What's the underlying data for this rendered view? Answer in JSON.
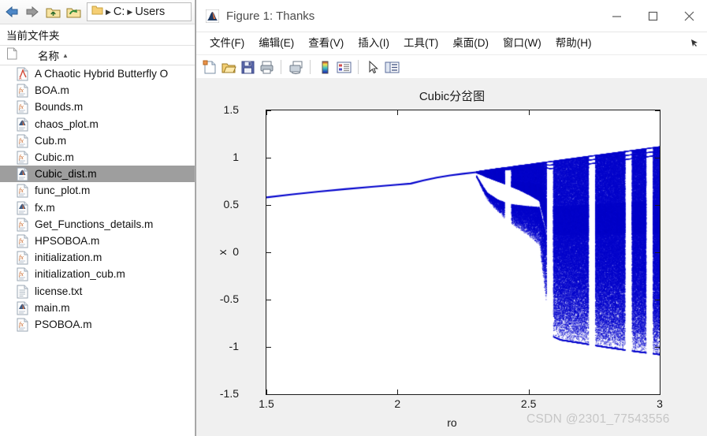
{
  "explorer": {
    "nav": {
      "back_icon": "back-arrow-icon",
      "forward_icon": "forward-arrow-icon",
      "up_icon": "up-folder-icon",
      "refresh_icon": "refresh-folder-icon"
    },
    "path": {
      "root_icon": "folder-icon",
      "crumbs": [
        "C:",
        "Users"
      ]
    },
    "panel_title": "当前文件夹",
    "column_header": {
      "label": "名称",
      "sort": "▲"
    },
    "files": [
      {
        "name": "A Chaotic Hybrid Butterfly O",
        "icon": "pdf-file-icon",
        "selected": false
      },
      {
        "name": "BOA.m",
        "icon": "m-function-icon",
        "selected": false
      },
      {
        "name": "Bounds.m",
        "icon": "m-function-icon",
        "selected": false
      },
      {
        "name": "chaos_plot.m",
        "icon": "m-script-icon",
        "selected": false
      },
      {
        "name": "Cub.m",
        "icon": "m-function-icon",
        "selected": false
      },
      {
        "name": "Cubic.m",
        "icon": "m-function-icon",
        "selected": false
      },
      {
        "name": "Cubic_dist.m",
        "icon": "m-script-icon",
        "selected": true
      },
      {
        "name": "func_plot.m",
        "icon": "m-function-icon",
        "selected": false
      },
      {
        "name": "fx.m",
        "icon": "m-script-icon",
        "selected": false
      },
      {
        "name": "Get_Functions_details.m",
        "icon": "m-function-icon",
        "selected": false
      },
      {
        "name": "HPSOBOA.m",
        "icon": "m-function-icon",
        "selected": false
      },
      {
        "name": "initialization.m",
        "icon": "m-function-icon",
        "selected": false
      },
      {
        "name": "initialization_cub.m",
        "icon": "m-function-icon",
        "selected": false
      },
      {
        "name": "license.txt",
        "icon": "text-file-icon",
        "selected": false
      },
      {
        "name": "main.m",
        "icon": "m-script-icon",
        "selected": false
      },
      {
        "name": "PSOBOA.m",
        "icon": "m-function-icon",
        "selected": false
      }
    ]
  },
  "figure": {
    "title": "Figure 1: Thanks",
    "app_icon": "matlab-figure-icon",
    "window_controls": {
      "minimize": "–",
      "maximize": "□",
      "close": "✕"
    },
    "menus": [
      {
        "label": "文件(F)"
      },
      {
        "label": "编辑(E)"
      },
      {
        "label": "查看(V)"
      },
      {
        "label": "插入(I)"
      },
      {
        "label": "工具(T)"
      },
      {
        "label": "桌面(D)"
      },
      {
        "label": "窗口(W)"
      },
      {
        "label": "帮助(H)"
      }
    ],
    "menu_overflow_icon": "overflow-arrow-icon",
    "toolbar": [
      {
        "name": "new-figure-icon"
      },
      {
        "name": "open-file-icon"
      },
      {
        "name": "save-figure-icon"
      },
      {
        "name": "print-figure-icon"
      },
      {
        "sep": true
      },
      {
        "name": "link-plot-icon"
      },
      {
        "sep": true
      },
      {
        "name": "colorbar-icon"
      },
      {
        "name": "legend-icon"
      },
      {
        "sep": true
      },
      {
        "name": "pointer-select-icon"
      },
      {
        "name": "plot-browser-icon"
      }
    ],
    "watermark": "CSDN @2301_77543556"
  },
  "chart_data": {
    "type": "scatter",
    "title": "Cubic分岔图",
    "xlabel": "ro",
    "ylabel": "x",
    "xlim": [
      1.5,
      3
    ],
    "ylim": [
      -1.5,
      1.5
    ],
    "xticks": [
      1.5,
      2,
      2.5,
      3
    ],
    "xticklabels": [
      "1.5",
      "2",
      "2.5",
      "3"
    ],
    "yticks": [
      -1.5,
      -1,
      -0.5,
      0,
      0.5,
      1,
      1.5
    ],
    "yticklabels": [
      "-1.5",
      "-1",
      "-0.5",
      "0",
      "0.5",
      "1",
      "1.5"
    ],
    "grid": false,
    "legend": null,
    "color": "#0000cc",
    "marker": "dot",
    "description": "Bifurcation diagram of the cubic map x -> ro*x*(1-x^2); single stable branch for ro in [1.5, ~2.3] rising from x=0.58 to x=0.85, then period doubling and a broad chaotic band widening to x in [-1.08, 1.12] at ro=3, with several periodic windows appearing as vertical white gaps.",
    "branch_curve": [
      {
        "ro": 1.5,
        "x": 0.58
      },
      {
        "ro": 1.6,
        "x": 0.612
      },
      {
        "ro": 1.7,
        "x": 0.642
      },
      {
        "ro": 1.8,
        "x": 0.668
      },
      {
        "ro": 1.9,
        "x": 0.692
      },
      {
        "ro": 2.0,
        "x": 0.714
      },
      {
        "ro": 2.05,
        "x": 0.726
      },
      {
        "ro": 2.1,
        "x": 0.76
      },
      {
        "ro": 2.15,
        "x": 0.79
      },
      {
        "ro": 2.2,
        "x": 0.812
      },
      {
        "ro": 2.25,
        "x": 0.83
      },
      {
        "ro": 2.3,
        "x": 0.846
      }
    ],
    "bifurcation_start_ro": 2.3,
    "chaos_band": [
      {
        "ro": 2.3,
        "upper": 0.855,
        "lower": 0.8
      },
      {
        "ro": 2.34,
        "upper": 0.872,
        "lower": 0.56
      },
      {
        "ro": 2.38,
        "upper": 0.888,
        "lower": 0.43
      },
      {
        "ro": 2.42,
        "upper": 0.902,
        "lower": 0.33
      },
      {
        "ro": 2.46,
        "upper": 0.918,
        "lower": 0.25
      },
      {
        "ro": 2.5,
        "upper": 0.932,
        "lower": 0.17
      },
      {
        "ro": 2.54,
        "upper": 0.948,
        "lower": 0.08
      },
      {
        "ro": 2.58,
        "upper": 0.962,
        "lower": -0.88
      },
      {
        "ro": 2.62,
        "upper": 0.978,
        "lower": -0.93
      },
      {
        "ro": 2.7,
        "upper": 1.008,
        "lower": -0.965
      },
      {
        "ro": 2.8,
        "upper": 1.045,
        "lower": -1.01
      },
      {
        "ro": 2.9,
        "upper": 1.082,
        "lower": -1.05
      },
      {
        "ro": 3.0,
        "upper": 1.12,
        "lower": -1.085
      }
    ],
    "periodic_windows_ro": [
      2.42,
      2.58,
      2.74,
      2.88,
      2.96
    ]
  }
}
